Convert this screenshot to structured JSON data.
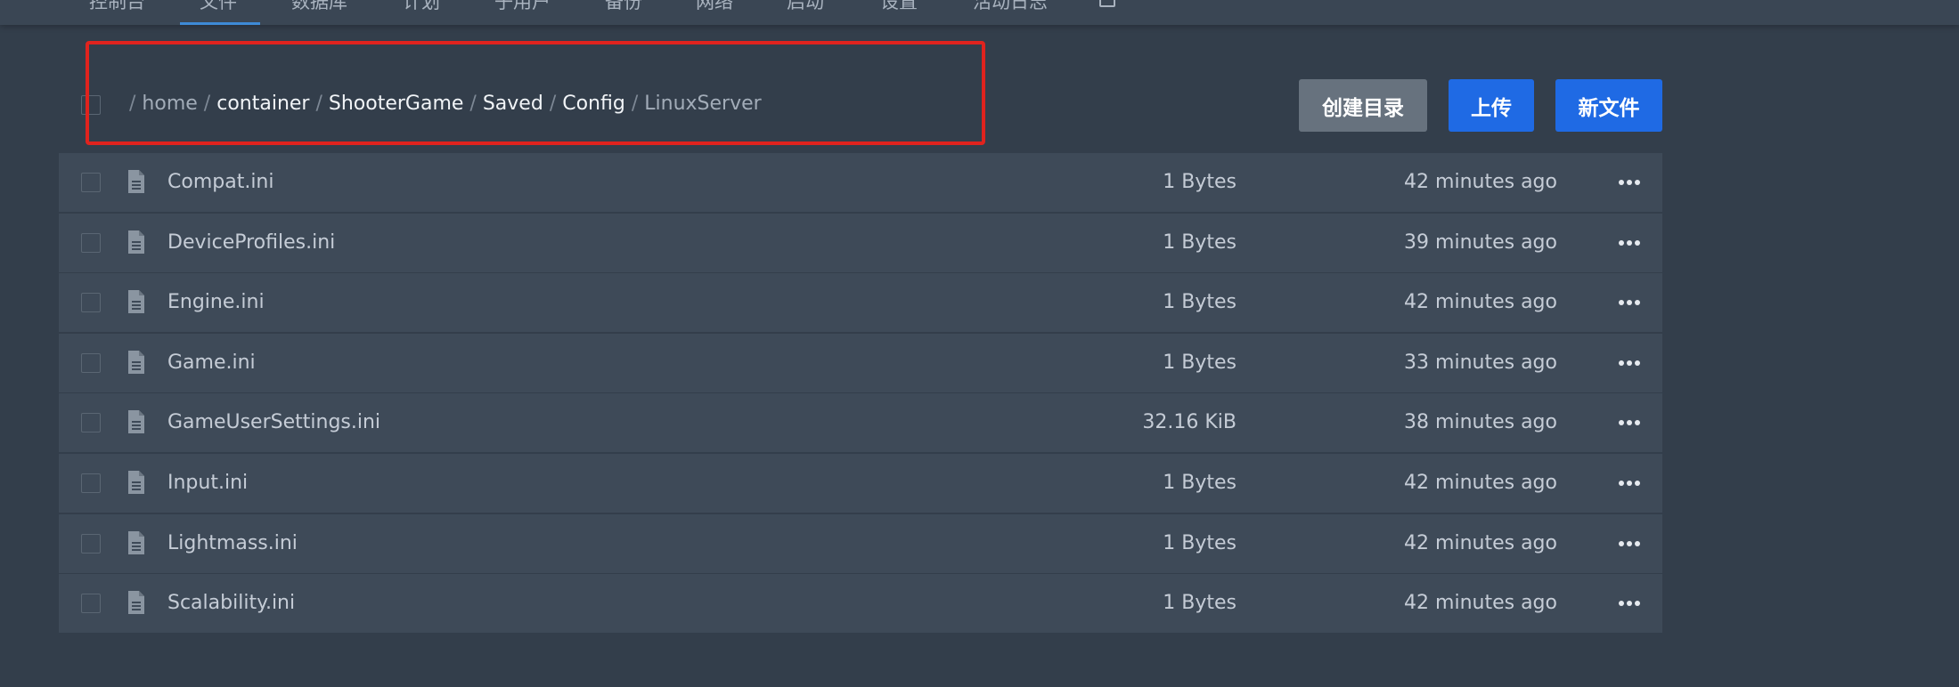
{
  "nav": {
    "items": [
      "控制台",
      "文件",
      "数据库",
      "计划",
      "子用户",
      "备份",
      "网络",
      "启动",
      "设置",
      "活动日志"
    ],
    "active_index": 1,
    "extra_icon": "external-box-icon"
  },
  "breadcrumb": {
    "separator": "/",
    "segments": [
      "home",
      "container",
      "ShooterGame",
      "Saved",
      "Config",
      "LinuxServer"
    ]
  },
  "actions": {
    "create_dir_label": "创建目录",
    "upload_label": "上传",
    "new_file_label": "新文件"
  },
  "files": [
    {
      "name": "Compat.ini",
      "size": "1 Bytes",
      "modified": "42 minutes ago"
    },
    {
      "name": "DeviceProfiles.ini",
      "size": "1 Bytes",
      "modified": "39 minutes ago"
    },
    {
      "name": "Engine.ini",
      "size": "1 Bytes",
      "modified": "42 minutes ago"
    },
    {
      "name": "Game.ini",
      "size": "1 Bytes",
      "modified": "33 minutes ago"
    },
    {
      "name": "GameUserSettings.ini",
      "size": "32.16 KiB",
      "modified": "38 minutes ago"
    },
    {
      "name": "Input.ini",
      "size": "1 Bytes",
      "modified": "42 minutes ago"
    },
    {
      "name": "Lightmass.ini",
      "size": "1 Bytes",
      "modified": "42 minutes ago"
    },
    {
      "name": "Scalability.ini",
      "size": "1 Bytes",
      "modified": "42 minutes ago"
    }
  ],
  "colors": {
    "background": "#333e4b",
    "row": "#3e4a58",
    "primary_button": "#1f6ae4",
    "secondary_button": "#67727e",
    "highlight": "#e0231e",
    "nav_active": "#3e8ad6"
  }
}
